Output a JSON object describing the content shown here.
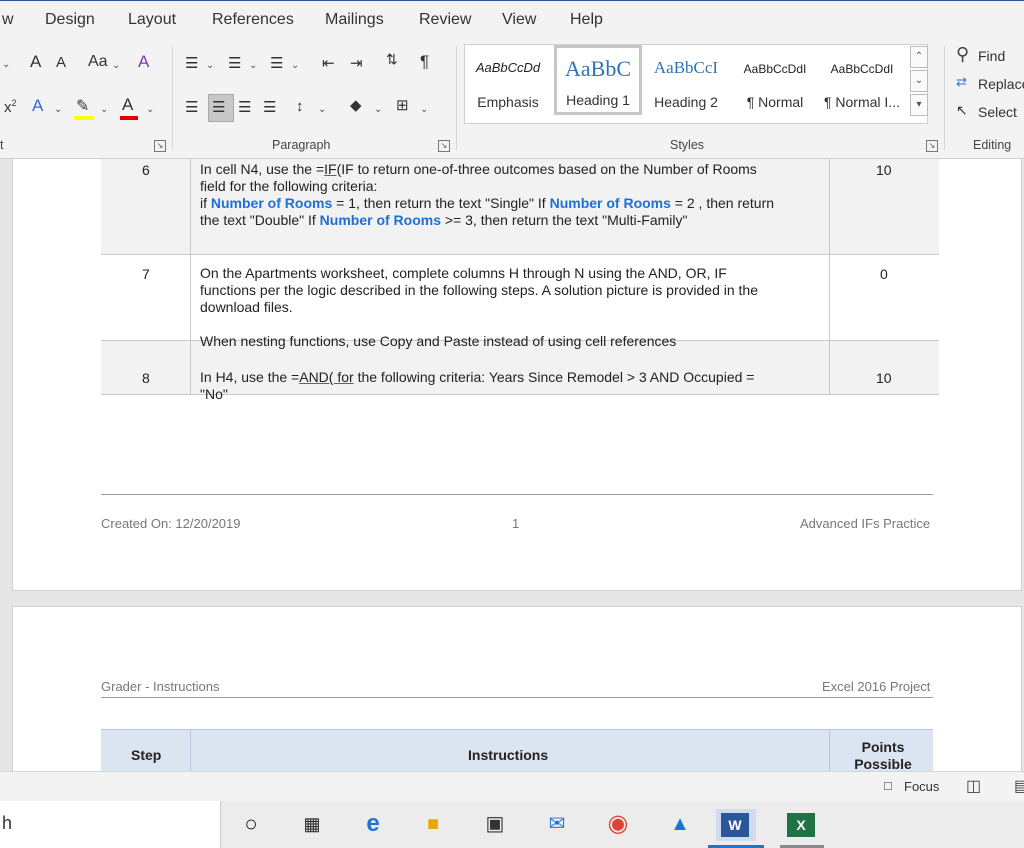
{
  "tabs": [
    "w",
    "Design",
    "Layout",
    "References",
    "Mailings",
    "Review",
    "View",
    "Help"
  ],
  "ribbon": {
    "font": {
      "grow": "A",
      "shrink": "A",
      "case": "Aa",
      "clear": "A",
      "superscript": "x",
      "sup_mark": "2",
      "effects": "A",
      "highlight": "✎",
      "color": "A"
    },
    "paragraph_label": "Paragraph",
    "styles_label": "Styles",
    "editing_label": "Editing",
    "styles": [
      {
        "sample": "AaBbCcDd",
        "name": "Emphasis"
      },
      {
        "sample": "AaBbC",
        "name": "Heading 1"
      },
      {
        "sample": "AaBbCcI",
        "name": "Heading 2"
      },
      {
        "sample": "AaBbCcDdI",
        "name": "¶ Normal"
      },
      {
        "sample": "AaBbCcDdI",
        "name": "¶ Normal I..."
      }
    ],
    "editing": {
      "find": "Find",
      "replace": "Replace",
      "select": "Select"
    },
    "left_edge_label": "t"
  },
  "document": {
    "rows": [
      {
        "step": "6",
        "points": "10",
        "text_lines": [
          [
            {
              "t": "In cell N4, use the ="
            },
            {
              "t": "IF",
              "u": true
            },
            {
              "t": "(IF to return one-of-three outcomes based on the Number of Rooms"
            }
          ],
          [
            {
              "t": "field for the following criteria:"
            }
          ],
          [
            {
              "t": "if "
            },
            {
              "t": "Number of Rooms",
              "b": true
            },
            {
              "t": " = 1, then return the text \"Single\"  If "
            },
            {
              "t": "Number of Rooms",
              "b": true
            },
            {
              "t": " = 2 , then return"
            }
          ],
          [
            {
              "t": "the text \"Double\"  If "
            },
            {
              "t": "Number of Rooms",
              "b": true
            },
            {
              "t": " >= 3, then return the text \"Multi-Family\""
            }
          ]
        ]
      },
      {
        "step": "7",
        "points": "0",
        "text_lines": [
          [
            {
              "t": "On the Apartments worksheet, complete columns H through N using the AND, OR, IF"
            }
          ],
          [
            {
              "t": "functions per the logic described in the following steps.  A solution picture is provided in the"
            }
          ],
          [
            {
              "t": "download files."
            }
          ],
          [
            {
              "t": ""
            }
          ],
          [
            {
              "t": "When nesting functions, use Copy and Paste instead of using cell references"
            }
          ]
        ]
      },
      {
        "step": "8",
        "points": "10",
        "text_lines": [
          [
            {
              "t": "In H4, use the ="
            },
            {
              "t": "AND( for",
              "u": true
            },
            {
              "t": " the following criteria:  Years Since Remodel > 3 AND Occupied ="
            }
          ],
          [
            {
              "t": "\"No\""
            }
          ]
        ]
      }
    ],
    "footer": {
      "created": "Created On: 12/20/2019",
      "page_num": "1",
      "title": "Advanced IFs Practice"
    },
    "header2": {
      "left": "Grader - Instructions",
      "right": "Excel 2016 Project"
    },
    "table_head": {
      "step": "Step",
      "instructions": "Instructions",
      "points": "Points\nPossible"
    }
  },
  "status": {
    "focus": "Focus"
  },
  "taskbar": {
    "search_fragment": "h"
  }
}
